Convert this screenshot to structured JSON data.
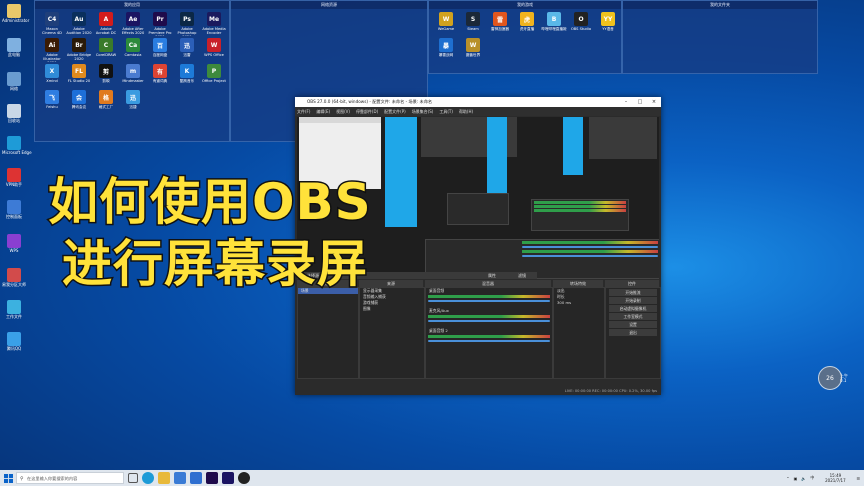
{
  "desktop_left": [
    {
      "label": "Administrator",
      "color": "#e8c86a"
    },
    {
      "label": "此电脑",
      "color": "#7fb0e0"
    },
    {
      "label": "网络",
      "color": "#6a9cd0"
    },
    {
      "label": "回收站",
      "color": "#c9d7e6"
    },
    {
      "label": "Microsoft Edge",
      "color": "#1e9bd7"
    },
    {
      "label": "VPN助手",
      "color": "#d33"
    },
    {
      "label": "控制面板",
      "color": "#3d7bd6"
    },
    {
      "label": "WPS",
      "color": "#8a3fd1"
    },
    {
      "label": "易我分区大师",
      "color": "#d24b4b"
    },
    {
      "label": "工作文件",
      "color": "#3cb1e0"
    },
    {
      "label": "腾讯QQ",
      "color": "#3aa0e8"
    }
  ],
  "fence1": {
    "title": "我的应用",
    "apps": [
      {
        "label": "Maxon Cinema 4D",
        "abbr": "C4",
        "color": "#1f3f7a"
      },
      {
        "label": "Adobe Audition 2020",
        "abbr": "Au",
        "color": "#0a2f5c"
      },
      {
        "label": "Adobe Acrobat DC",
        "abbr": "A",
        "color": "#d21c1c"
      },
      {
        "label": "Adobe After Effects 2020",
        "abbr": "Ae",
        "color": "#1b1462"
      },
      {
        "label": "Adobe Premiere Pro 2020",
        "abbr": "Pr",
        "color": "#1f0b4b"
      },
      {
        "label": "Adobe Photoshop 2020",
        "abbr": "Ps",
        "color": "#0b2745"
      },
      {
        "label": "Adobe Media Encoder",
        "abbr": "Me",
        "color": "#1b1a5e"
      },
      {
        "label": "Adobe Illustrator 2020",
        "abbr": "Ai",
        "color": "#3a1b05"
      },
      {
        "label": "Adobe Bridge 2020",
        "abbr": "Br",
        "color": "#2a1a08"
      },
      {
        "label": "CorelDRAW",
        "abbr": "C",
        "color": "#3a7a2a"
      },
      {
        "label": "Camtasia",
        "abbr": "Ca",
        "color": "#2c8a3c"
      },
      {
        "label": "百度网盘",
        "abbr": "百",
        "color": "#2a7de1"
      },
      {
        "label": "迅雷",
        "abbr": "迅",
        "color": "#2b5fb8"
      },
      {
        "label": "WPS Office",
        "abbr": "W",
        "color": "#c8202a"
      },
      {
        "label": "Xmind",
        "abbr": "X",
        "color": "#2f8bd8"
      },
      {
        "label": "FL Studio 20",
        "abbr": "FL",
        "color": "#e08a1e"
      },
      {
        "label": "剪映",
        "abbr": "剪",
        "color": "#111"
      },
      {
        "label": "Mindmaster",
        "abbr": "m",
        "color": "#4a7bd0"
      },
      {
        "label": "有道词典",
        "abbr": "有",
        "color": "#d43"
      },
      {
        "label": "酷狗音乐",
        "abbr": "K",
        "color": "#1d7ad8"
      },
      {
        "label": "Office Project",
        "abbr": "P",
        "color": "#3d8a3d"
      },
      {
        "label": "Feishu",
        "abbr": "飞",
        "color": "#2f7de1"
      },
      {
        "label": "腾讯会议",
        "abbr": "会",
        "color": "#1d6fd8"
      },
      {
        "label": "格式工厂",
        "abbr": "格",
        "color": "#e07a1e"
      },
      {
        "label": "迅捷",
        "abbr": "迅",
        "color": "#3a9be0"
      }
    ]
  },
  "fence2": {
    "title": "网络资源"
  },
  "fence3": {
    "title": "我的游戏",
    "apps": [
      {
        "label": "WeGame",
        "abbr": "W",
        "color": "#d1a21e"
      },
      {
        "label": "Steam",
        "abbr": "S",
        "color": "#1b2838"
      },
      {
        "label": "雷神加速器",
        "abbr": "雷",
        "color": "#e0561e"
      },
      {
        "label": "虎牙直播",
        "abbr": "虎",
        "color": "#f0b31e"
      },
      {
        "label": "哔哩哔哩直播姬",
        "abbr": "B",
        "color": "#5ab8e8"
      },
      {
        "label": "OBS Studio",
        "abbr": "O",
        "color": "#222"
      },
      {
        "label": "YY语音",
        "abbr": "YY",
        "color": "#f0c21e"
      },
      {
        "label": "暴雪战网",
        "abbr": "暴",
        "color": "#1e6fd0"
      },
      {
        "label": "魔兽世界",
        "abbr": "W",
        "color": "#b8902a"
      }
    ]
  },
  "fence4": {
    "title": "我的文件夹"
  },
  "obs": {
    "title": "OBS 27.0.0 (64-bit, windows) - 配置文件: 未命名 - 场景: 未命名",
    "menu": [
      "文件(F)",
      "编辑(E)",
      "视图(V)",
      "停靠部件(D)",
      "配置文件(P)",
      "场景集合(S)",
      "工具(T)",
      "帮助(H)"
    ],
    "sources_title": "来源",
    "sources": [
      "显示器采集",
      "音频输入捕获",
      "游戏捕获",
      "图像"
    ],
    "mixer_title": "混音器",
    "mixer": [
      {
        "name": "桌面音频",
        "db": "0.0 dB"
      },
      {
        "name": "麦克风/Aux",
        "db": "0.0 dB"
      },
      {
        "name": "桌面音频 2",
        "db": "0.0 dB"
      }
    ],
    "transition_title": "转场特效",
    "transition_opts": [
      "淡出",
      "时长",
      "300 ms"
    ],
    "controls_title": "控件",
    "controls": [
      "开始推流",
      "开始录制",
      "启动虚拟摄像机",
      "工作室模式",
      "设置",
      "退出"
    ],
    "scene_title": "场景",
    "scene_item": "场景",
    "no_source": "未选择源",
    "props_label": "属性",
    "filters_label": "滤镜",
    "status": "LIVE: 00:00:00   REC: 00:00:00   CPU: 0.2%, 30.00 fps"
  },
  "overlay": {
    "line1": "如何使用OBS",
    "line2": "进行屏幕录屏"
  },
  "taskbar": {
    "search_placeholder": "在这里输入你要搜索的内容",
    "time": "15:49",
    "date": "2021/7/17",
    "tray_lang": "中"
  },
  "side_widget": {
    "value": "26",
    "line1": "上午",
    "line2": "0.1"
  }
}
